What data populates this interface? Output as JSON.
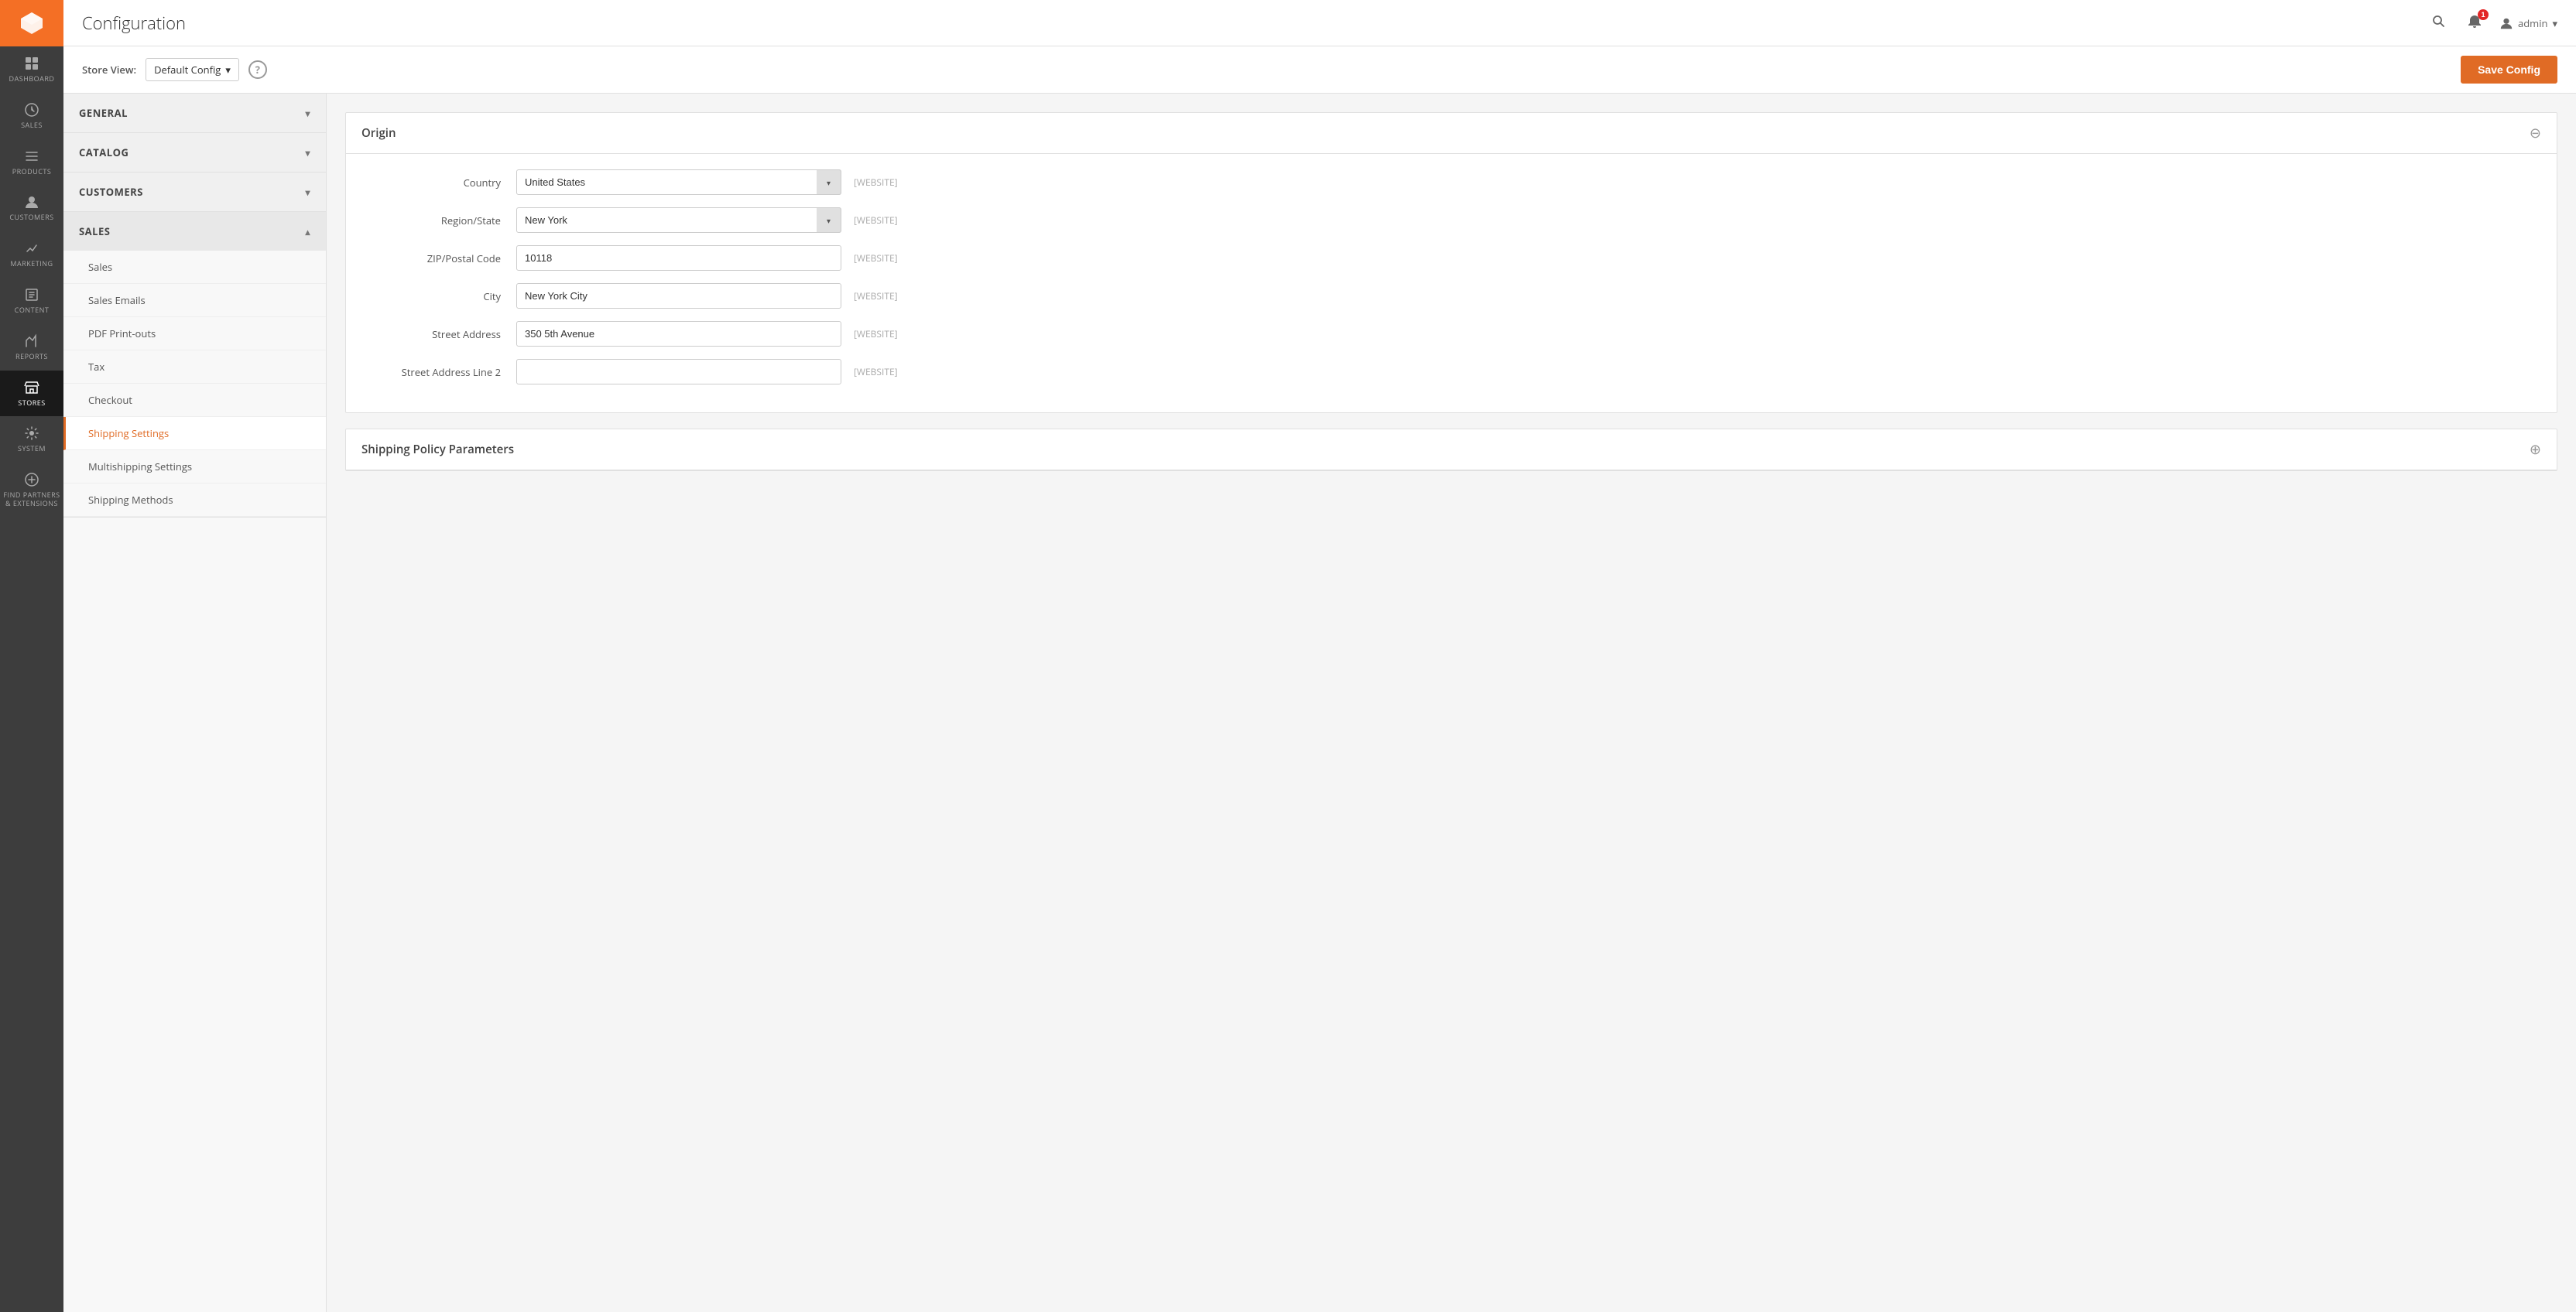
{
  "page": {
    "title": "Configuration"
  },
  "header": {
    "search_tooltip": "Search",
    "notification_count": "1",
    "admin_label": "admin",
    "dropdown_arrow": "▾"
  },
  "toolbar": {
    "store_view_label": "Store View:",
    "store_view_value": "Default Config",
    "help_label": "?",
    "save_button_label": "Save Config"
  },
  "sidebar": {
    "items": [
      {
        "id": "dashboard",
        "label": "Dashboard",
        "icon": "dashboard"
      },
      {
        "id": "sales",
        "label": "Sales",
        "icon": "sales"
      },
      {
        "id": "products",
        "label": "Products",
        "icon": "products"
      },
      {
        "id": "customers",
        "label": "Customers",
        "icon": "customers"
      },
      {
        "id": "marketing",
        "label": "Marketing",
        "icon": "marketing"
      },
      {
        "id": "content",
        "label": "Content",
        "icon": "content"
      },
      {
        "id": "reports",
        "label": "Reports",
        "icon": "reports"
      },
      {
        "id": "stores",
        "label": "Stores",
        "icon": "stores",
        "active": true
      },
      {
        "id": "system",
        "label": "System",
        "icon": "system"
      },
      {
        "id": "find-partners",
        "label": "Find Partners & Extensions",
        "icon": "find-partners"
      }
    ]
  },
  "left_nav": {
    "sections": [
      {
        "id": "general",
        "label": "General",
        "expanded": false
      },
      {
        "id": "catalog",
        "label": "Catalog",
        "expanded": false
      },
      {
        "id": "customers",
        "label": "Customers",
        "expanded": false
      },
      {
        "id": "sales",
        "label": "Sales",
        "expanded": true,
        "items": [
          {
            "id": "sales",
            "label": "Sales",
            "active": false
          },
          {
            "id": "sales-emails",
            "label": "Sales Emails",
            "active": false
          },
          {
            "id": "pdf-print-outs",
            "label": "PDF Print-outs",
            "active": false
          },
          {
            "id": "tax",
            "label": "Tax",
            "active": false
          },
          {
            "id": "checkout",
            "label": "Checkout",
            "active": false
          },
          {
            "id": "shipping-settings",
            "label": "Shipping Settings",
            "active": true
          },
          {
            "id": "multishipping-settings",
            "label": "Multishipping Settings",
            "active": false
          },
          {
            "id": "shipping-methods",
            "label": "Shipping Methods",
            "active": false
          }
        ]
      }
    ]
  },
  "origin_section": {
    "title": "Origin",
    "fields": {
      "country": {
        "label": "Country",
        "value": "United States",
        "side_label": "[WEBSITE]"
      },
      "region_state": {
        "label": "Region/State",
        "value": "New York",
        "side_label": "[WEBSITE]"
      },
      "zip_postal_code": {
        "label": "ZIP/Postal Code",
        "value": "10118",
        "side_label": "[WEBSITE]"
      },
      "city": {
        "label": "City",
        "value": "New York City",
        "side_label": "[WEBSITE]"
      },
      "street_address": {
        "label": "Street Address",
        "value": "350 5th Avenue",
        "side_label": "[WEBSITE]"
      },
      "street_address_line2": {
        "label": "Street Address Line 2",
        "value": "",
        "placeholder": "",
        "side_label": "[WEBSITE]"
      }
    }
  },
  "shipping_policy_section": {
    "title": "Shipping Policy Parameters"
  }
}
